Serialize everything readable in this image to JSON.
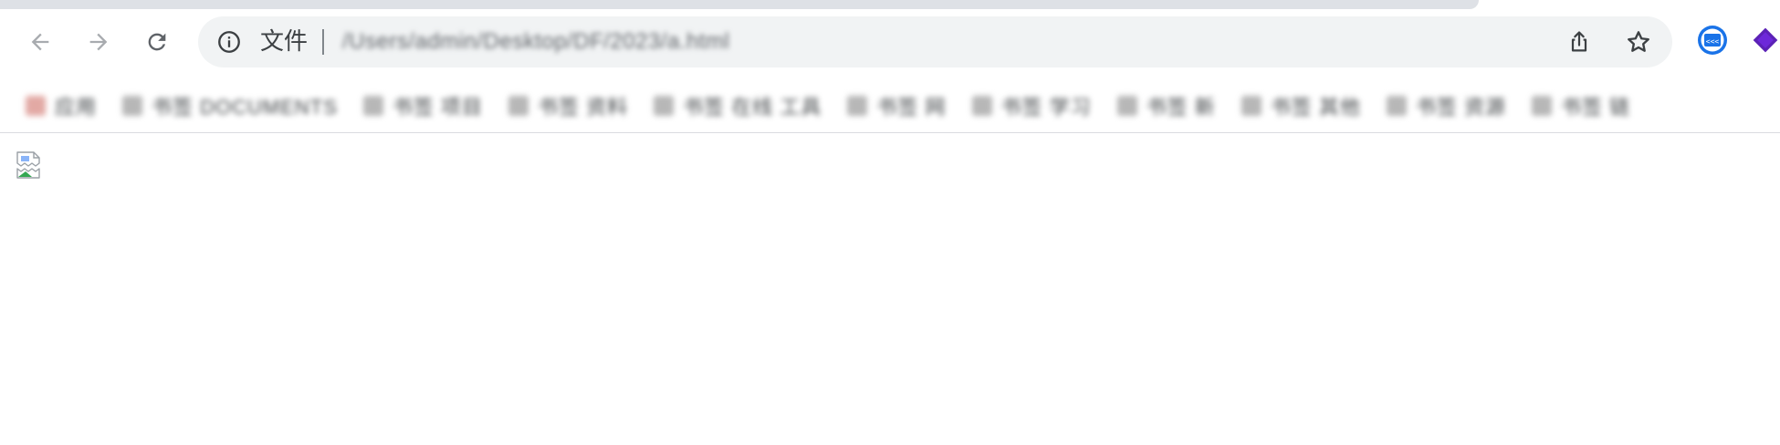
{
  "toolbar": {
    "back_icon": "arrow-left-icon",
    "forward_icon": "arrow-right-icon",
    "reload_icon": "reload-icon"
  },
  "omnibox": {
    "security_icon": "info-icon",
    "scheme_label": "文件",
    "url": "/Users/admin/Desktop/DF/2023/a.html"
  },
  "omnibox_actions": {
    "share_icon": "share-icon",
    "bookmark_star_icon": "star-icon"
  },
  "extensions": [
    {
      "icon": "extension-dev-icon",
      "accent": "#1a73e8"
    },
    {
      "icon": "extension-purple-icon",
      "accent": "#5b21b6"
    }
  ],
  "bookmarks": [
    {
      "label": "应用"
    },
    {
      "label": "书签 DOCUMENTS"
    },
    {
      "label": "书签 项目"
    },
    {
      "label": "书签 资料"
    },
    {
      "label": "书签 在线 工具"
    },
    {
      "label": "书签 网"
    },
    {
      "label": "书签 学习"
    },
    {
      "label": "书签 新"
    },
    {
      "label": "书签 其他"
    },
    {
      "label": "书签 资源"
    },
    {
      "label": "书签 链"
    }
  ],
  "page": {
    "content_icon": "broken-image-icon"
  },
  "colors": {
    "omnibox_bg": "#f1f3f4",
    "icon_gray": "#5f6368",
    "tab_strip": "#dee1e6"
  }
}
